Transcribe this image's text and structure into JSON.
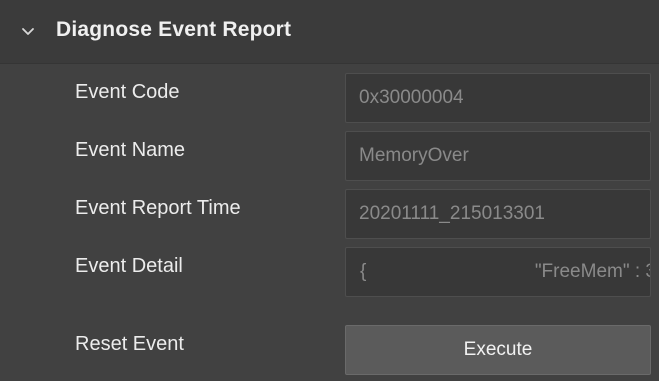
{
  "group": {
    "title": "Diagnose Event Report",
    "expanded_icon": "chevron-down-icon"
  },
  "rows": [
    {
      "label": "Event Code",
      "value": "0x30000004"
    },
    {
      "label": "Event Name",
      "value": "MemoryOver"
    },
    {
      "label": "Event Report Time",
      "value": "20201111_215013301"
    },
    {
      "label": "Event Detail",
      "value_brace": "{",
      "value_text": "\"FreeMem\" : 3"
    },
    {
      "label": "Reset Event",
      "button_label": "Execute"
    }
  ],
  "colors": {
    "background": "#414141",
    "header": "#3b3b3b",
    "field": "#383838",
    "button": "#5b5b5b"
  }
}
